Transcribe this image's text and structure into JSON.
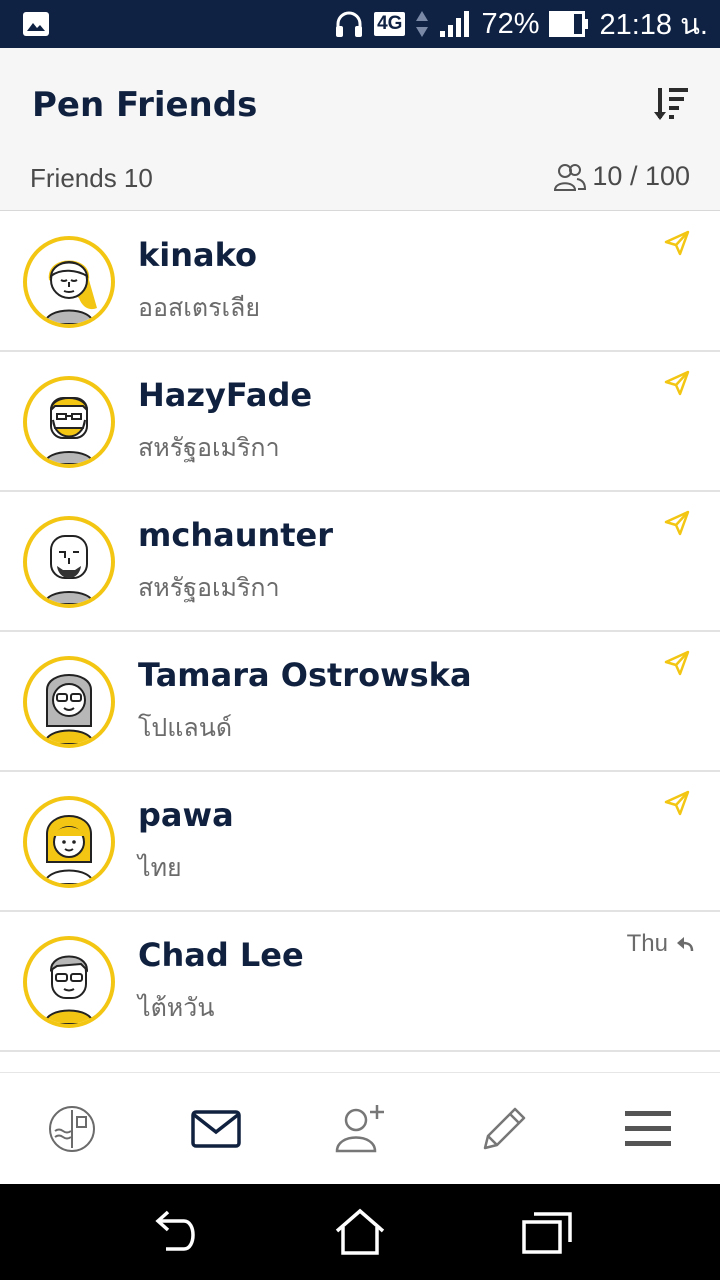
{
  "status_bar": {
    "network": "4G",
    "battery": "72%",
    "time": "21:18 น."
  },
  "header": {
    "title": "Pen Friends",
    "friends_count": "Friends 10",
    "capacity": "10 / 100"
  },
  "friends": [
    {
      "name": "kinako",
      "country": "ออสเตรเลีย",
      "action": "send",
      "avatar": "girl-yellow-hair-avatar"
    },
    {
      "name": "HazyFade",
      "country": "สหรัฐอเมริกา",
      "action": "send",
      "avatar": "bearded-man-avatar"
    },
    {
      "name": "mchaunter",
      "country": "สหรัฐอเมริกา",
      "action": "send",
      "avatar": "bald-bearded-man-avatar"
    },
    {
      "name": "Tamara Ostrowska",
      "country": "โปแลนด์",
      "action": "send",
      "avatar": "woman-glasses-avatar"
    },
    {
      "name": "pawa",
      "country": "ไทย",
      "action": "send",
      "avatar": "woman-yellow-hair-avatar"
    },
    {
      "name": "Chad Lee",
      "country": "ไต้หวัน",
      "action": "replied",
      "last_activity": "Thu",
      "avatar": "man-glasses-avatar"
    }
  ],
  "nav": [
    "stamp-icon",
    "mail-icon",
    "add-friend-icon",
    "pen-icon",
    "menu-icon"
  ],
  "colors": {
    "accent": "#f3c613",
    "navy": "#10213f",
    "status_bar": "#0f2244"
  }
}
